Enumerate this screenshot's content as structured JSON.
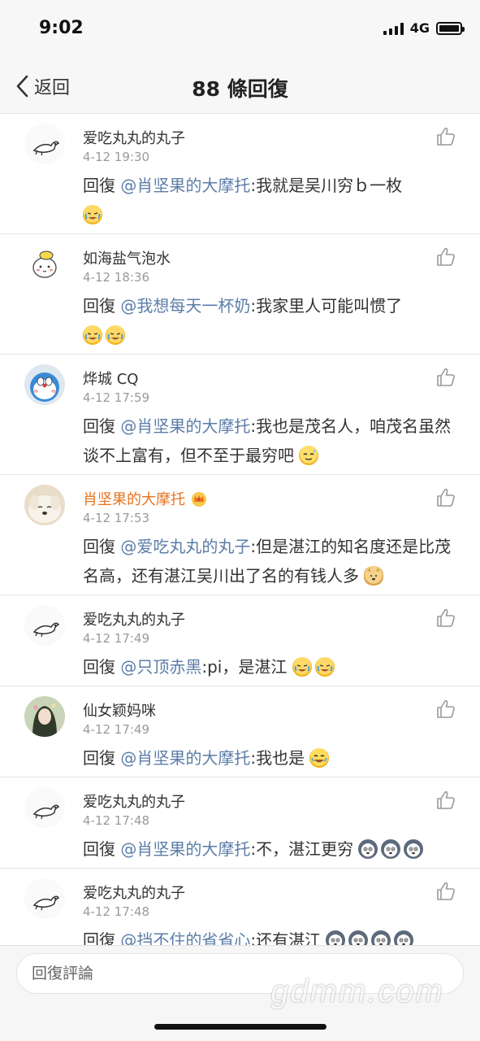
{
  "status_bar": {
    "time": "9:02",
    "network": "4G"
  },
  "nav": {
    "back_label": "返回",
    "title": "88 條回復"
  },
  "comments": [
    {
      "name": "爱吃丸丸的丸子",
      "time": "4-12 19:30",
      "reply_prefix": "回復 ",
      "mention": "@肖坚果的大摩托",
      "text": ":我就是吴川穷ｂ一枚",
      "emojis": [
        "cry-laugh"
      ]
    },
    {
      "name": "如海盐气泡水",
      "time": "4-12 18:36",
      "reply_prefix": "回復 ",
      "mention": "@我想每天一杯奶",
      "text": ":我家里人可能叫惯了",
      "emojis": [
        "cry-laugh",
        "cry-laugh"
      ]
    },
    {
      "name": "烨城 CQ",
      "time": "4-12 17:59",
      "reply_prefix": "回復 ",
      "mention": "@肖坚果的大摩托",
      "text": ":我也是茂名人，咱茂名虽然谈不上富有，但不至于最穷吧",
      "emojis": [
        "sweat"
      ]
    },
    {
      "name": "肖坚果的大摩托",
      "vip": true,
      "time": "4-12 17:53",
      "reply_prefix": "回復 ",
      "mention": "@爱吃丸丸的丸子",
      "text": ":但是湛江的知名度还是比茂名高，还有湛江吴川出了名的有钱人多",
      "emojis": [
        "doge"
      ]
    },
    {
      "name": "爱吃丸丸的丸子",
      "time": "4-12 17:49",
      "reply_prefix": "回復 ",
      "mention": "@只顶赤黑",
      "text": ":pi，是湛江",
      "emojis": [
        "cry-laugh",
        "cry-laugh"
      ]
    },
    {
      "name": "仙女颖妈咪",
      "time": "4-12 17:49",
      "reply_prefix": "回復 ",
      "mention": "@肖坚果的大摩托",
      "text": ":我也是",
      "emojis": [
        "laugh"
      ]
    },
    {
      "name": "爱吃丸丸的丸子",
      "time": "4-12 17:48",
      "reply_prefix": "回復 ",
      "mention": "@肖坚果的大摩托",
      "text": ":不，湛江更穷",
      "emojis": [
        "husky",
        "husky",
        "husky"
      ]
    },
    {
      "name": "爱吃丸丸的丸子",
      "time": "4-12 17:48",
      "reply_prefix": "回復 ",
      "mention": "@挡不住的省省心",
      "text": ":还有湛江",
      "emojis": [
        "husky",
        "husky",
        "husky",
        "husky"
      ]
    }
  ],
  "bottom": {
    "input_placeholder": "回復評論",
    "watermark": "gdmm.com"
  }
}
